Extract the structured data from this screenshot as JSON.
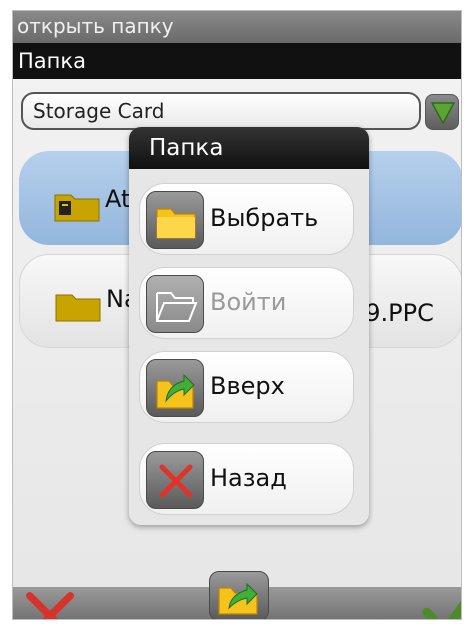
{
  "window": {
    "title": "открыть папку"
  },
  "section": {
    "label": "Папка"
  },
  "storage": {
    "selected": "Storage Card"
  },
  "list": {
    "items": [
      {
        "label": "At",
        "selected": true
      },
      {
        "label": "Na",
        "tail": "59.PPC",
        "selected": false
      }
    ]
  },
  "popup": {
    "title": "Папка",
    "buttons": [
      {
        "label": "Выбрать",
        "icon": "folder-icon",
        "enabled": true
      },
      {
        "label": "Войти",
        "icon": "open-folder-icon",
        "enabled": false
      },
      {
        "label": "Вверх",
        "icon": "folder-up-icon",
        "enabled": true
      },
      {
        "label": "Назад",
        "icon": "close-icon",
        "enabled": true
      }
    ]
  },
  "toolbar": {
    "cancel_icon": "close-icon",
    "up_icon": "folder-up-icon",
    "ok_icon": "check-icon"
  },
  "colors": {
    "accent_green": "#4f8a2a",
    "selected_item": "#9dbde0",
    "cancel_red": "#d8332b",
    "folder_yellow": "#f2c230"
  }
}
